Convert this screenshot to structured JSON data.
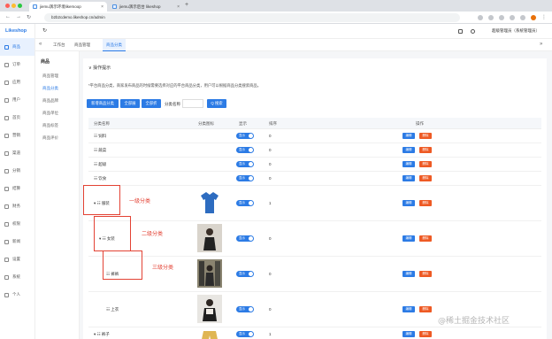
{
  "browser": {
    "tabs": [
      {
        "label": "jiemu演示环境likemoop",
        "active": true
      },
      {
        "label": "jiemu演示后台 likeshop",
        "active": false
      }
    ],
    "url": "b2b2cdemo.likeshop.cn/admin"
  },
  "sidebar": {
    "logo": "Likeshop",
    "items": [
      {
        "label": "商品",
        "active": true
      },
      {
        "label": "订单"
      },
      {
        "label": "应用"
      },
      {
        "label": "用户"
      },
      {
        "label": "首页"
      },
      {
        "label": "营销"
      },
      {
        "label": "渠道"
      },
      {
        "label": "分销"
      },
      {
        "label": "结算"
      },
      {
        "label": "财务"
      },
      {
        "label": "权限"
      },
      {
        "label": "新闻"
      },
      {
        "label": "设置"
      },
      {
        "label": "系统"
      },
      {
        "label": "个人"
      }
    ]
  },
  "header": {
    "user": "超级管理员（系统管理员）"
  },
  "pagetabs": [
    "工作台",
    "商品管理",
    "商品分类"
  ],
  "submenu": {
    "title": "商品",
    "items": [
      {
        "label": "商品管理"
      },
      {
        "label": "商品分类",
        "active": true
      },
      {
        "label": "商品品牌"
      },
      {
        "label": "商品单位"
      },
      {
        "label": "商品标签"
      },
      {
        "label": "商品评价"
      }
    ]
  },
  "content": {
    "tips_title": "操作提示",
    "tips_text": "*平台商品分类，商家发布商品的时候需要选择对应的平台商品分类，用户可以根据商品分类搜索商品。",
    "buttons": {
      "add": "新增商品分类",
      "expand": "全部展开",
      "collapse": "全部折叠",
      "search": "Q 搜索"
    },
    "search_label": "分类名称",
    "table": {
      "headers": [
        "分类名称",
        "分类图标",
        "显示",
        "排序",
        "操作"
      ],
      "toggle_label": "显示",
      "edit_label": "编辑",
      "delete_label": "删除",
      "rows": [
        {
          "name": "饲料",
          "sort": "0",
          "level": 1,
          "tall": false
        },
        {
          "name": "蔬菜",
          "sort": "0",
          "level": 1,
          "tall": false
        },
        {
          "name": "超级",
          "sort": "0",
          "level": 1,
          "tall": false
        },
        {
          "name": "饮食",
          "sort": "0",
          "level": 1,
          "tall": false
        },
        {
          "name": "服装",
          "sort": "1",
          "level": 1,
          "tall": true,
          "expanded": true,
          "img": "tshirt"
        },
        {
          "name": "女装",
          "sort": "0",
          "level": 2,
          "tall": true,
          "expanded": true,
          "img": "photo"
        },
        {
          "name": "裤裤",
          "sort": "0",
          "level": 3,
          "tall": true,
          "img": "photo2"
        },
        {
          "name": "上衣",
          "sort": "0",
          "level": 3,
          "tall": true,
          "img": "photo3"
        },
        {
          "name": "裤子",
          "sort": "1",
          "level": 1,
          "tall": false,
          "expanded": true,
          "img": "pants"
        }
      ]
    }
  },
  "annotations": {
    "level1": "一级分类",
    "level2": "二级分类",
    "level3": "三级分类"
  },
  "watermark": "@稀土掘金技术社区",
  "colors": {
    "primary": "#2c7be5",
    "danger": "#ee5a24",
    "annotation": "#e34234"
  }
}
